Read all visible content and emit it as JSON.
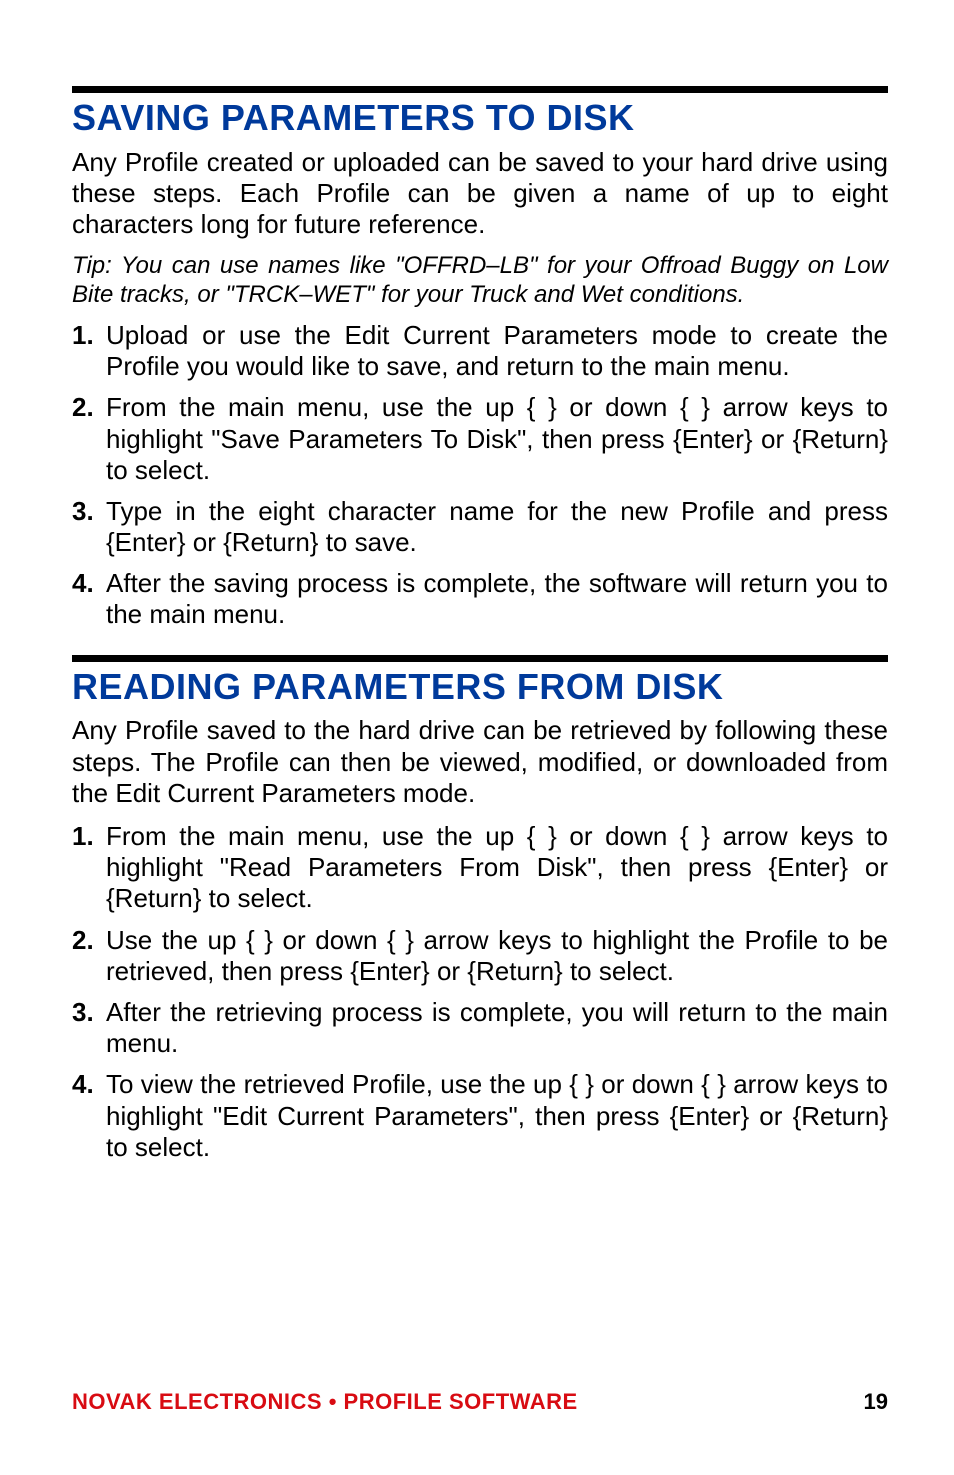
{
  "sections": [
    {
      "heading": "SAVING PARAMETERS TO DISK",
      "intro": "Any Profile created or uploaded can be saved to your hard drive using these steps. Each Profile can be given a name of up to eight characters long for future reference.",
      "tip": "Tip:  You can use names like \"OFFRD–LB\" for your Offroad Buggy on Low Bite tracks, or \"TRCK–WET\" for your Truck and Wet conditions.",
      "steps": [
        "Upload or use the Edit Current Parameters mode to create the Profile you would like to save, and return to the main menu.",
        "From the main menu, use the up {    } or down {    } arrow keys to highlight \"Save Parameters To Disk\", then press {Enter} or {Return} to select.",
        "Type in the eight character name for the new Profile and press {Enter} or {Return} to save.",
        "After the saving process is complete, the software will return you to the main menu."
      ]
    },
    {
      "heading": "READING PARAMETERS FROM DISK",
      "intro": "Any Profile saved to the hard drive can be retrieved by following these steps. The Profile can then be viewed, modified, or downloaded from the Edit Current Parameters mode.",
      "tip": "",
      "steps": [
        "From the main menu, use the up {    } or down {    } arrow keys to highlight \"Read Parameters From Disk\", then press {Enter} or {Return} to select.",
        "Use the up {    } or down {    } arrow keys to highlight the Profile to be retrieved, then press {Enter} or {Return} to select.",
        "After the retrieving process is complete, you will return to the main menu.",
        "To view the retrieved Profile, use the up {    } or down {    } arrow keys to highlight \"Edit Current Parameters\", then press {Enter} or {Return} to select."
      ]
    }
  ],
  "footer": {
    "left": "NOVAK ELECTRONICS • PROFILE SOFTWARE",
    "page": "19"
  }
}
